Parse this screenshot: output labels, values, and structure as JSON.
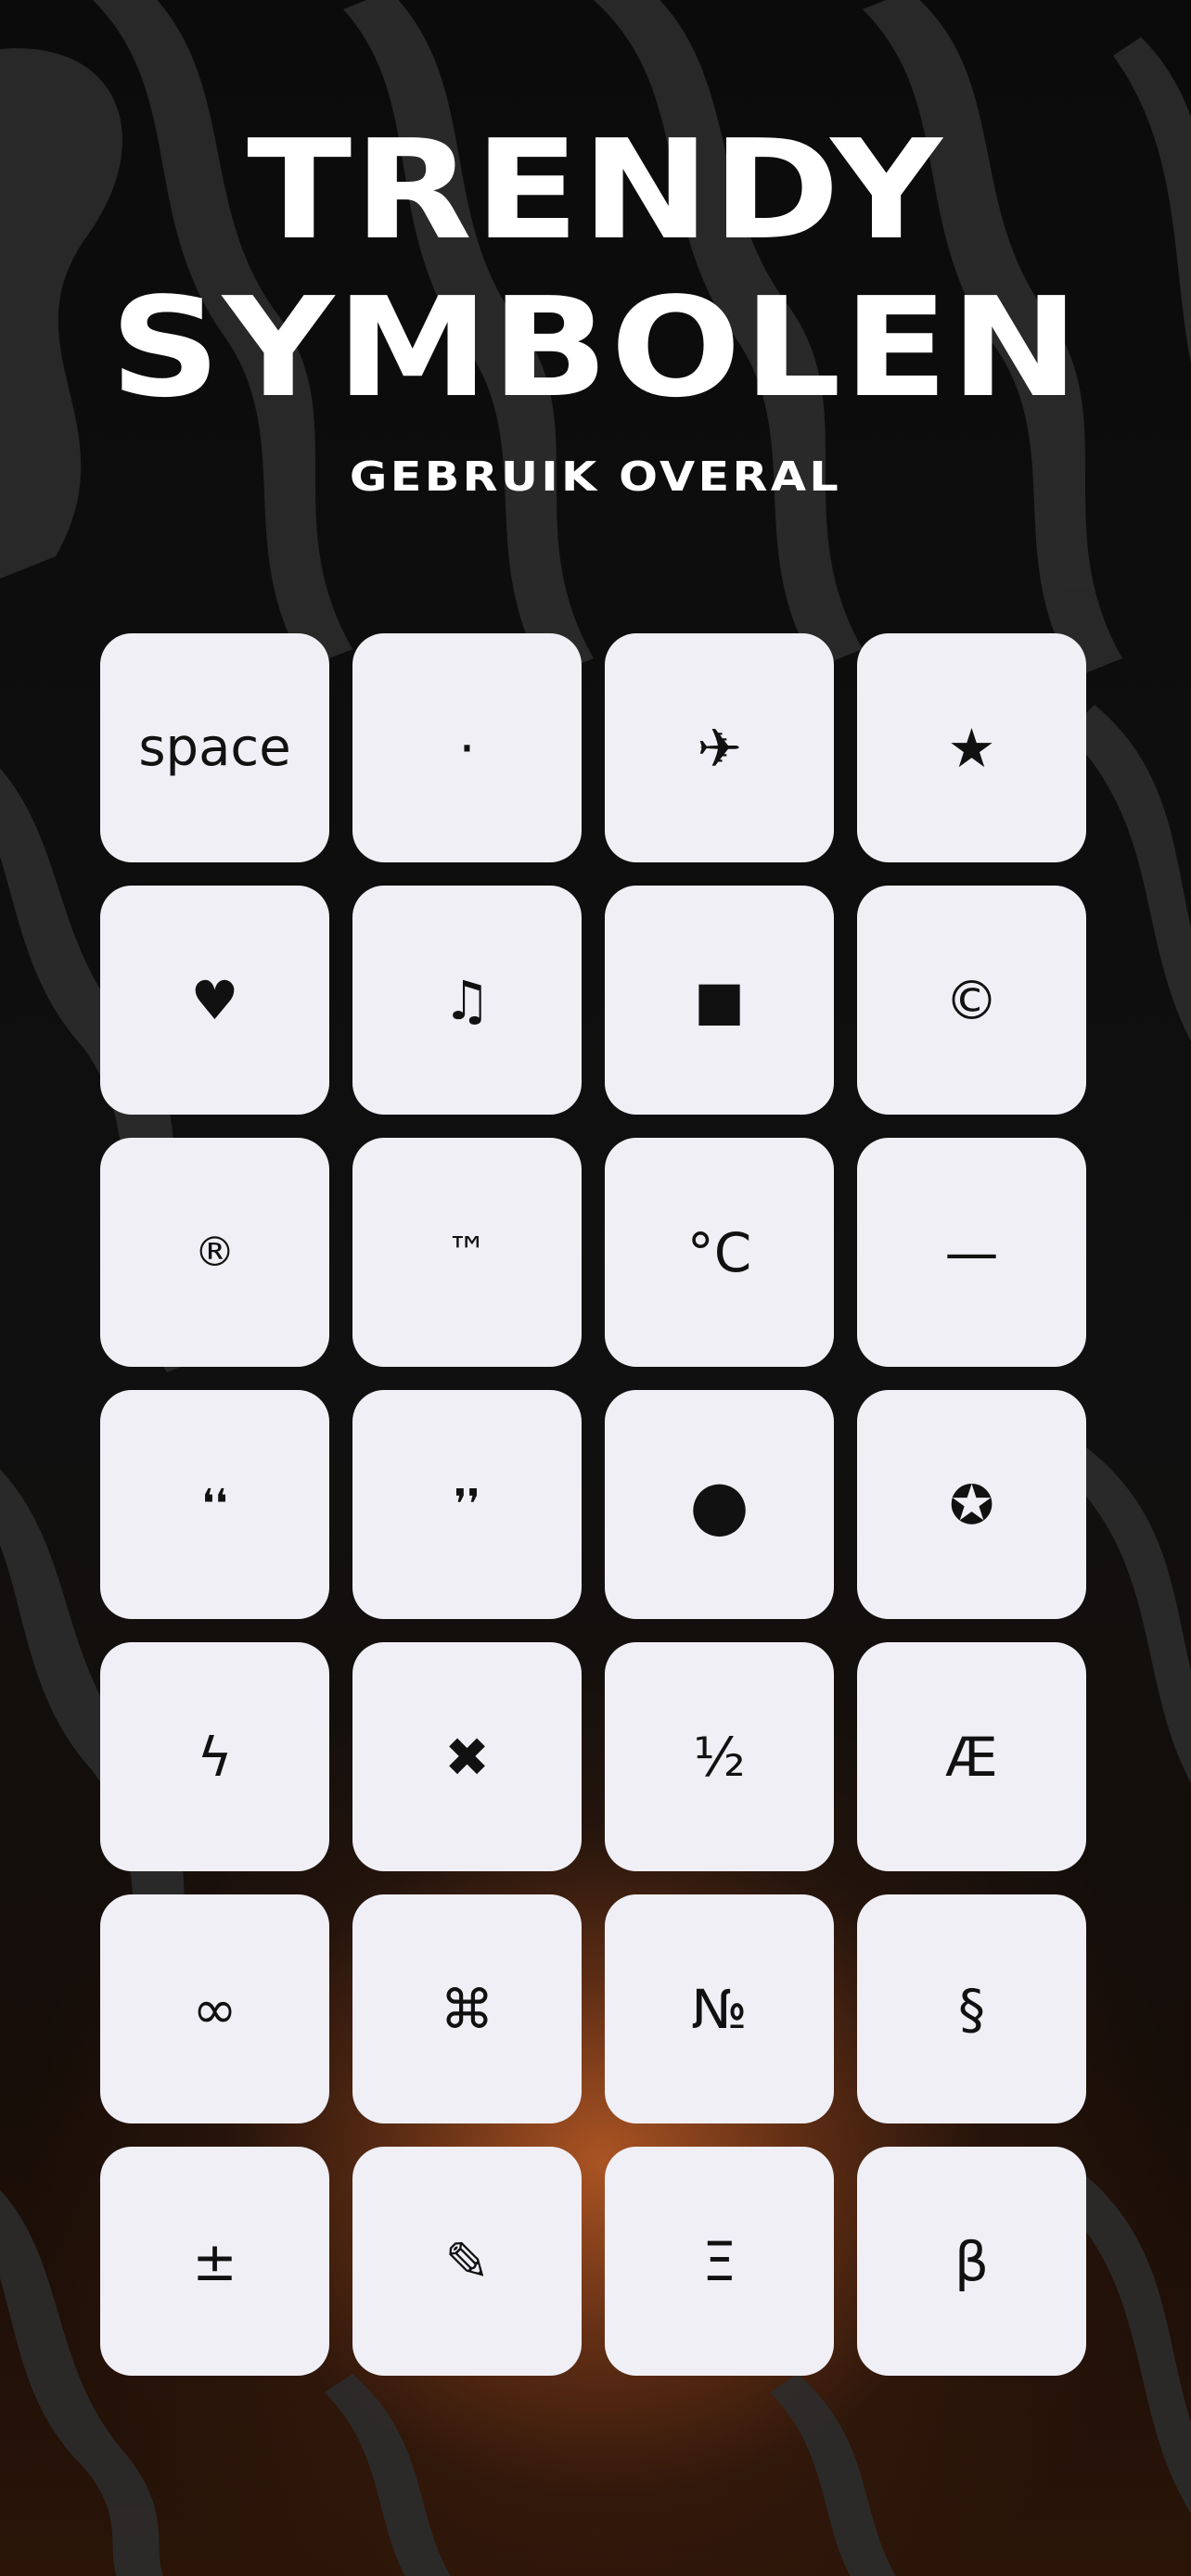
{
  "header": {
    "title_line_1": "TRENDY",
    "title_line_2": "SYMBOLEN",
    "subtitle": "GEBRUIK OVERAL"
  },
  "symbols": [
    {
      "glyph": "space",
      "icon": "space-key"
    },
    {
      "glyph": "·",
      "icon": "middle-dot"
    },
    {
      "glyph": "✈",
      "icon": "airplane-icon"
    },
    {
      "glyph": "★",
      "icon": "star-icon"
    },
    {
      "glyph": "♥",
      "icon": "heart-icon"
    },
    {
      "glyph": "♫",
      "icon": "music-note-icon"
    },
    {
      "glyph": "■",
      "icon": "square-icon"
    },
    {
      "glyph": "©",
      "icon": "copyright-symbol"
    },
    {
      "glyph": "®",
      "icon": "registered-symbol"
    },
    {
      "glyph": "™",
      "icon": "trademark-symbol"
    },
    {
      "glyph": "°C",
      "icon": "celsius-symbol"
    },
    {
      "glyph": "—",
      "icon": "em-dash-symbol"
    },
    {
      "glyph": "❛❛",
      "icon": "opening-quote-icon"
    },
    {
      "glyph": "❜❜",
      "icon": "closing-quote-icon"
    },
    {
      "glyph": "●",
      "icon": "circle-icon"
    },
    {
      "glyph": "✪",
      "icon": "circled-star-icon"
    },
    {
      "glyph": "ϟ",
      "icon": "lightning-icon"
    },
    {
      "glyph": "✖",
      "icon": "cross-icon"
    },
    {
      "glyph": "½",
      "icon": "one-half-symbol"
    },
    {
      "glyph": "Æ",
      "icon": "ae-ligature-symbol"
    },
    {
      "glyph": "∞",
      "icon": "infinity-symbol"
    },
    {
      "glyph": "⌘",
      "icon": "command-symbol"
    },
    {
      "glyph": "№",
      "icon": "numero-symbol"
    },
    {
      "glyph": "§",
      "icon": "section-symbol"
    },
    {
      "glyph": "±",
      "icon": "plus-minus-symbol"
    },
    {
      "glyph": "✎",
      "icon": "pencil-icon"
    },
    {
      "glyph": "Ξ",
      "icon": "xi-symbol"
    },
    {
      "glyph": "β",
      "icon": "beta-symbol"
    }
  ]
}
